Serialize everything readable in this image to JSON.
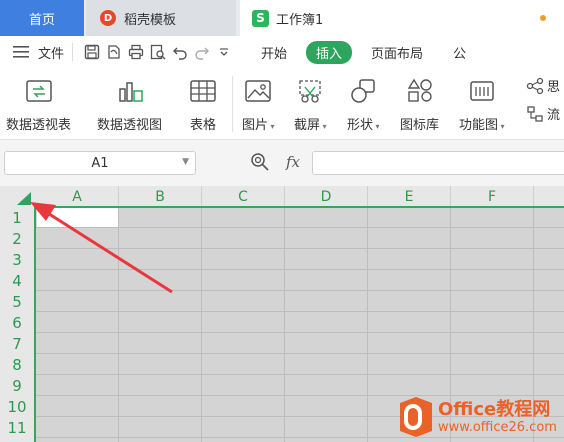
{
  "tabs": {
    "home": "首页",
    "daoke": "稻壳模板",
    "workbook": "工作簿1"
  },
  "menubar": {
    "menu_icon": "hamburger-icon",
    "file": "文件",
    "start": "开始",
    "insert": "插入",
    "page_layout": "页面布局",
    "formula_partial": "公"
  },
  "ribbon": {
    "pivot_table": "数据透视表",
    "pivot_chart": "数据透视图",
    "table": "表格",
    "picture": "图片",
    "screenshot": "截屏",
    "shapes": "形状",
    "icon_library": "图标库",
    "function_chart": "功能图",
    "partial_top": "思",
    "partial_bottom": "流"
  },
  "formula_bar": {
    "name_box": "A1",
    "fx": "fx",
    "formula_value": ""
  },
  "sheet": {
    "columns": [
      "A",
      "B",
      "C",
      "D",
      "E",
      "F"
    ],
    "rows": [
      "1",
      "2",
      "3",
      "4",
      "5",
      "6",
      "7",
      "8",
      "9",
      "10",
      "11"
    ]
  },
  "watermark": {
    "title": "Office教程网",
    "url": "www.office26.com"
  },
  "colors": {
    "accent_green": "#2ea55f",
    "home_tab_blue": "#3f7fe0",
    "annotation_arrow_red": "#e8383d",
    "watermark_orange": "#e9622a"
  }
}
